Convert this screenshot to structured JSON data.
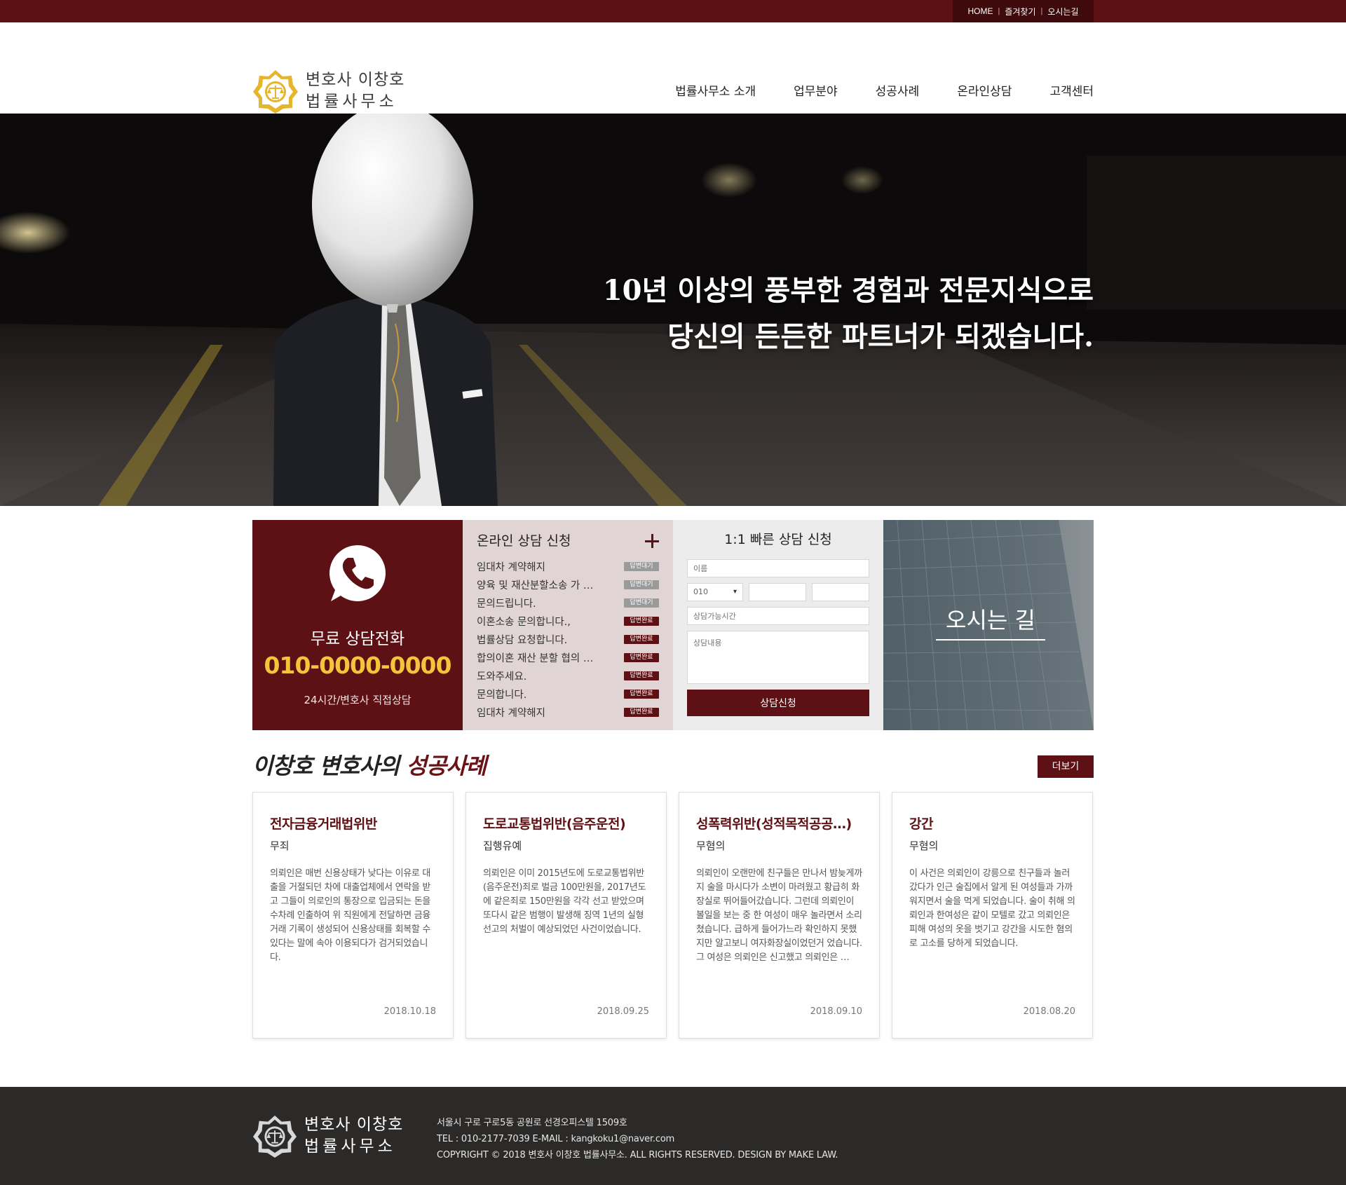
{
  "topbar": {
    "links": [
      "HOME",
      "즐겨찾기",
      "오시는길"
    ],
    "separator": "|"
  },
  "header": {
    "logo_line1": "변호사 이창호",
    "logo_line2": "법률사무소",
    "nav": [
      "법률사무소 소개",
      "업무분야",
      "성공사례",
      "온라인상담",
      "고객센터"
    ]
  },
  "hero": {
    "line1": "10년 이상의 풍부한 경험과 전문지식으로",
    "line2": "당신의 든든한 파트너가 되겠습니다."
  },
  "call": {
    "icon": "phone-chat-icon",
    "label": "무료 상담전화",
    "number": "010-0000-0000",
    "hours": "24시간/변호사 직접상담"
  },
  "online": {
    "title": "온라인 상담 신청",
    "items": [
      {
        "title": "임대차 계약해지",
        "status": "답변대기"
      },
      {
        "title": "양육 및 재산분할소송 가 …",
        "status": "답변대기"
      },
      {
        "title": "문의드립니다.",
        "status": "답변대기"
      },
      {
        "title": "이혼소송 문의합니다.,",
        "status": "답변완료"
      },
      {
        "title": "법률상담 요청합니다.",
        "status": "답변완료"
      },
      {
        "title": "합의이혼 재산 분할 협의 …",
        "status": "답변완료"
      },
      {
        "title": "도와주세요.",
        "status": "답변완료"
      },
      {
        "title": "문의합니다.",
        "status": "답변완료"
      },
      {
        "title": "임대차 계약해지",
        "status": "답변완료"
      }
    ],
    "colors": {
      "waiting": "#9a9a9a",
      "done": "#5e1114"
    }
  },
  "quick": {
    "title": "1:1 빠른 상담 신청",
    "name_placeholder": "이름",
    "phone_prefix": "010",
    "time_placeholder": "상담가능시간",
    "content_placeholder": "상담내용",
    "submit": "상담신청"
  },
  "directions": {
    "label": "오시는 길"
  },
  "success": {
    "title_prefix": "이창호 변호사의",
    "title_accent": "성공사례",
    "more": "더보기",
    "cards": [
      {
        "title": "전자금융거래법위반",
        "result": "무죄",
        "body": "의뢰인은 매번 신용상태가 낮다는 이유로 대출을 거절되던 차에 대출업체에서 연락을 받고 그들이 의로인의 통장으로 입금되는 돈을 수차례 인출하여 위 직원에게 전달하면 금융거래 기록이 생성되어 신용상태를 회복할 수 있다는 말에 속아 이용되다가 검거되었습니다.",
        "date": "2018.10.18"
      },
      {
        "title": "도로교통법위반(음주운전)",
        "result": "집행유예",
        "body": "의뢰인은 이미 2015년도에 도로교통법위반(음주운전)죄로 벌금 100만원을, 2017년도에 같은죄로 150만원을 각각 선고 받았으며 또다시 같은 범행이 발생해 징역 1년의 실형 선고의 처벌이 예상되었던 사건이었습니다.",
        "date": "2018.09.25"
      },
      {
        "title": "성폭력위반(성적목적공공…)",
        "result": "무혐의",
        "body": "의뢰인이 오랜만에 친구들은 만나서 밤늦게까지 술을 마시다가 소변이 마려웠고 황급히 화장실로 뛰어들어갔습니다. 그런데 의뢰인이 볼일을 보는 중 한 여성이 매우 놀라면서 소리쳤습니다. 급하게 들어가느라 확인하지 못했지만 알고보니 여자화장실이었던거 었습니다. 그 여성은 의뢰인은 신고했고 의뢰인은 …",
        "date": "2018.09.10"
      },
      {
        "title": "강간",
        "result": "무혐의",
        "body": "이 사건은 의뢰인이 강릉으로 친구들과 놀러갔다가 인근 술집에서 알게 된 여성들과 가까워지면서 술을 먹게 되었습니다. 술이 취해 의뢰인과 한여성은 같이 모텔로 갔고 의뢰인은 피해 여성의 옷을 벗기고 강간을 시도한 혐의로 고소를 당하게 되었습니다.",
        "date": "2018.08.20"
      }
    ]
  },
  "footer": {
    "logo_line1": "변호사 이창호",
    "logo_line2": "법률사무소",
    "address": "서울시 구로 구로5동 공원로 선경오피스텔 1509호",
    "contact": "TEL : 010-2177-7039  E-MAIL : kangkoku1@naver.com",
    "copyright": "COPYRIGHT © 2018 변호사 이창호 법률사무소. ALL RIGHTS RESERVED. DESIGN BY MAKE LAW."
  },
  "colors": {
    "brand": "#5e1114",
    "accent_gold": "#f4c53b",
    "footer_bg": "#2b2a29"
  }
}
